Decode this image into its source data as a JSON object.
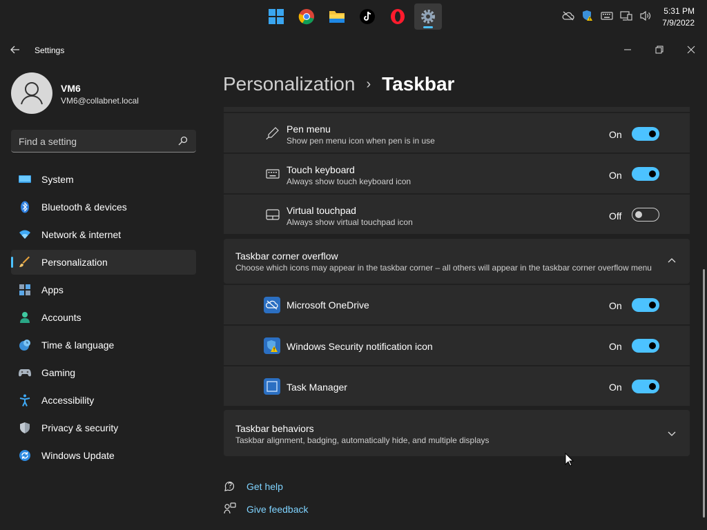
{
  "taskbar": {
    "apps": [
      {
        "name": "windows-start-icon"
      },
      {
        "name": "chrome-icon"
      },
      {
        "name": "file-explorer-icon"
      },
      {
        "name": "tiktok-icon"
      },
      {
        "name": "opera-icon"
      },
      {
        "name": "settings-gear-icon",
        "active": true
      }
    ],
    "tray_icons": [
      "onedrive-offline-icon",
      "windows-security-icon",
      "touch-keyboard-icon",
      "network-icon",
      "volume-icon"
    ],
    "time": "5:31 PM",
    "date": "7/9/2022"
  },
  "window": {
    "title": "Settings"
  },
  "user": {
    "name": "VM6",
    "email": "VM6@collabnet.local"
  },
  "search": {
    "placeholder": "Find a setting"
  },
  "nav": {
    "items": [
      {
        "label": "System",
        "icon": "system-icon"
      },
      {
        "label": "Bluetooth & devices",
        "icon": "bluetooth-icon"
      },
      {
        "label": "Network & internet",
        "icon": "wifi-icon"
      },
      {
        "label": "Personalization",
        "icon": "brush-icon",
        "selected": true
      },
      {
        "label": "Apps",
        "icon": "apps-icon"
      },
      {
        "label": "Accounts",
        "icon": "accounts-icon"
      },
      {
        "label": "Time & language",
        "icon": "time-language-icon"
      },
      {
        "label": "Gaming",
        "icon": "gaming-icon"
      },
      {
        "label": "Accessibility",
        "icon": "accessibility-icon"
      },
      {
        "label": "Privacy & security",
        "icon": "shield-icon"
      },
      {
        "label": "Windows Update",
        "icon": "windows-update-icon"
      }
    ]
  },
  "breadcrumb": {
    "parent": "Personalization",
    "separator": "›",
    "current": "Taskbar"
  },
  "pen_rows": [
    {
      "title": "Pen menu",
      "desc": "Show pen menu icon when pen is in use",
      "state": "On"
    },
    {
      "title": "Touch keyboard",
      "desc": "Always show touch keyboard icon",
      "state": "On"
    },
    {
      "title": "Virtual touchpad",
      "desc": "Always show virtual touchpad icon",
      "state": "Off"
    }
  ],
  "overflow_section": {
    "title": "Taskbar corner overflow",
    "desc": "Choose which icons may appear in the taskbar corner – all others will appear in the taskbar corner overflow menu",
    "rows": [
      {
        "title": "Microsoft OneDrive",
        "state": "On"
      },
      {
        "title": "Windows Security notification icon",
        "state": "On"
      },
      {
        "title": "Task Manager",
        "state": "On"
      }
    ]
  },
  "behaviors_section": {
    "title": "Taskbar behaviors",
    "desc": "Taskbar alignment, badging, automatically hide, and multiple displays"
  },
  "links": {
    "help": "Get help",
    "feedback": "Give feedback"
  },
  "colors": {
    "accent": "#4cc2ff",
    "background": "#202020",
    "card": "#2b2b2b"
  }
}
